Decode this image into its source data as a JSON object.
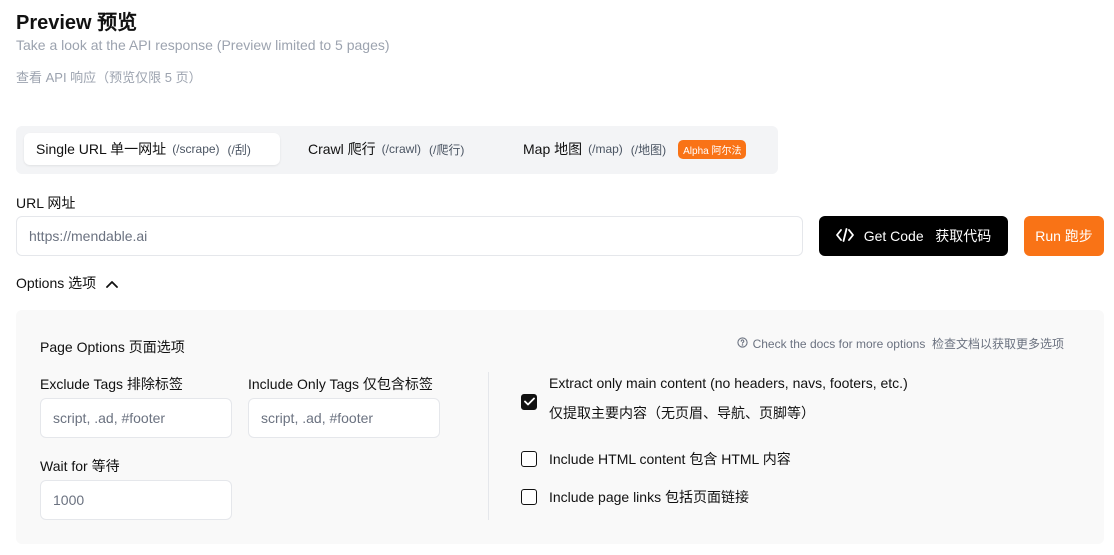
{
  "header": {
    "title": "Preview 预览",
    "subtitle": "Take a look at the API response (Preview limited to 5 pages)",
    "subtitle_zh": "查看 API 响应（预览仅限 5 页）"
  },
  "tabs": [
    {
      "label": "Single URL 单一网址",
      "path": "(/scrape)",
      "path_zh": "(/刮)",
      "active": true
    },
    {
      "label": "Crawl 爬行",
      "path": "(/crawl)",
      "path_zh": "(/爬行)",
      "active": false
    },
    {
      "label": "Map 地图",
      "path": "(/map)",
      "path_zh": "(/地图)",
      "badge": "Alpha 阿尔法",
      "active": false
    }
  ],
  "url": {
    "label": "URL 网址",
    "placeholder": "https://mendable.ai",
    "value": ""
  },
  "buttons": {
    "get_code": "Get Code   获取代码",
    "run": "Run 跑步"
  },
  "options": {
    "toggle_label": "Options 选项",
    "expanded": true,
    "page_options_title": "Page Options 页面选项",
    "docs_hint": "Check the docs for more options  检查文档以获取更多选项",
    "exclude_tags": {
      "label": "Exclude Tags 排除标签",
      "placeholder": "script, .ad, #footer"
    },
    "include_only_tags": {
      "label": "Include Only Tags 仅包含标签",
      "placeholder": "script, .ad, #footer"
    },
    "wait_for": {
      "label": "Wait for 等待",
      "placeholder": "1000"
    },
    "checkboxes": [
      {
        "label": "Extract only main content (no headers, navs, footers, etc.)",
        "label_zh": "仅提取主要内容（无页眉、导航、页脚等）",
        "checked": true
      },
      {
        "label": "Include HTML content 包含 HTML 内容",
        "checked": false
      },
      {
        "label": "Include page links 包括页面链接",
        "checked": false
      }
    ]
  },
  "colors": {
    "accent": "#f97316",
    "code_button": "#000000",
    "panel_bg": "#f9f9f9",
    "tabs_bg": "#f3f4f6"
  },
  "icons": {
    "get_code": "code-brackets-icon",
    "options_toggle": "chevron-up-icon",
    "docs_hint": "help-circle-icon",
    "checked": "checkmark-icon"
  }
}
